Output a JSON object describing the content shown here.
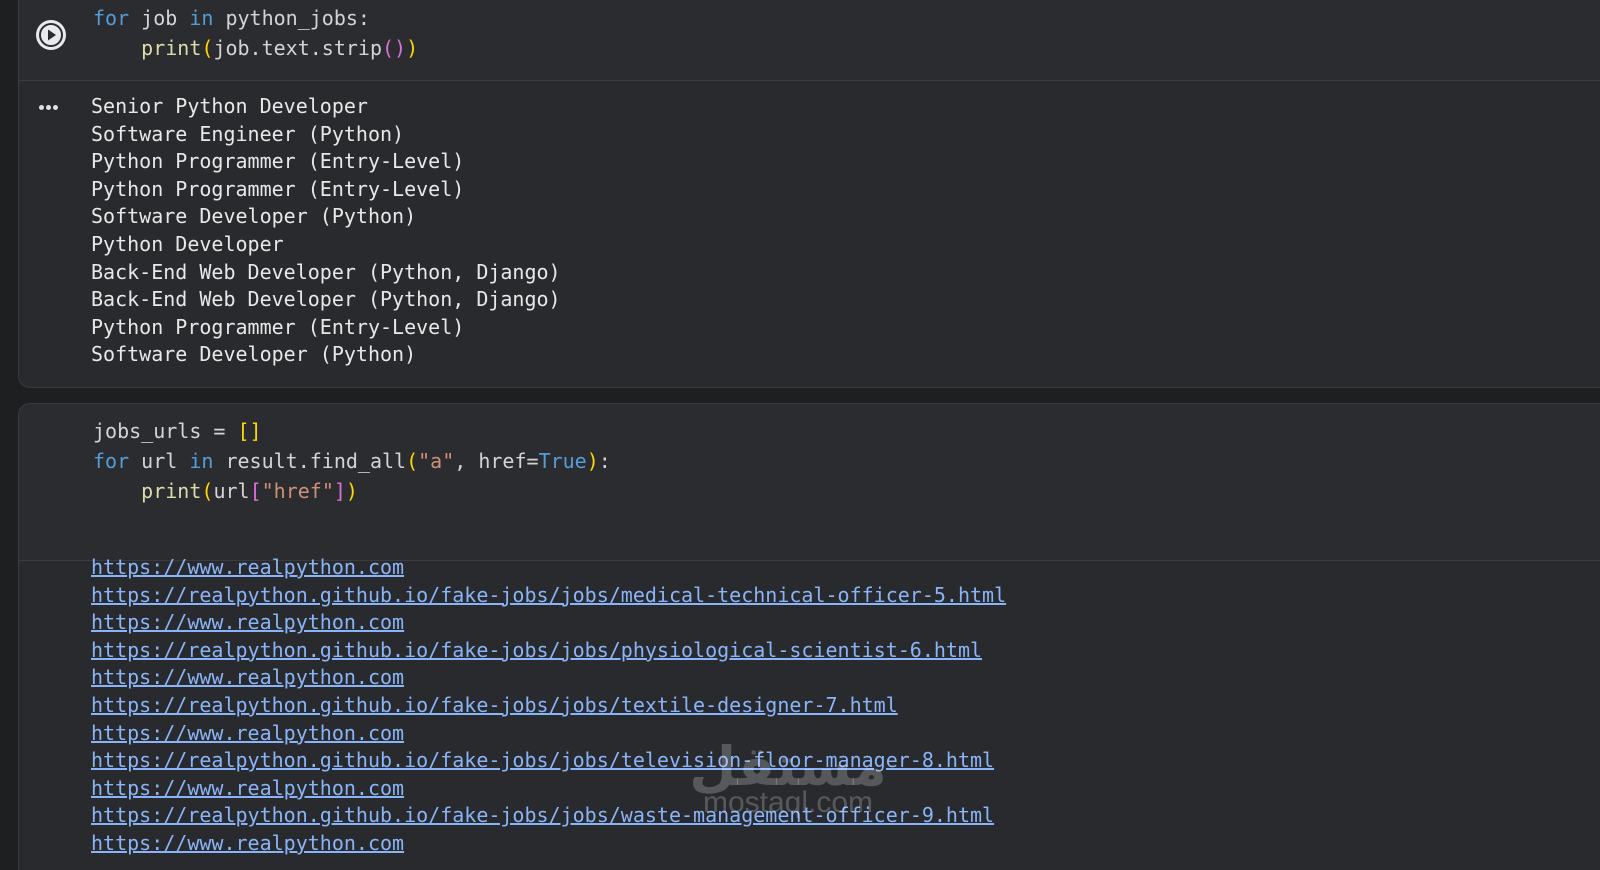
{
  "cell1": {
    "code_lines": [
      [
        {
          "t": "for",
          "c": "kw"
        },
        {
          "t": " job ",
          "c": "plain"
        },
        {
          "t": "in",
          "c": "kw"
        },
        {
          "t": " python_jobs:",
          "c": "plain"
        }
      ],
      [
        {
          "t": "    ",
          "c": "plain"
        },
        {
          "t": "print",
          "c": "fn"
        },
        {
          "t": "(",
          "c": "p1"
        },
        {
          "t": "job.text.strip",
          "c": "plain"
        },
        {
          "t": "()",
          "c": "p2"
        },
        {
          "t": ")",
          "c": "p1"
        }
      ]
    ],
    "output": [
      "Senior Python Developer",
      "Software Engineer (Python)",
      "Python Programmer (Entry-Level)",
      "Python Programmer (Entry-Level)",
      "Software Developer (Python)",
      "Python Developer",
      "Back-End Web Developer (Python, Django)",
      "Back-End Web Developer (Python, Django)",
      "Python Programmer (Entry-Level)",
      "Software Developer (Python)"
    ]
  },
  "cell2": {
    "code_lines": [
      [
        {
          "t": "jobs_urls = ",
          "c": "plain"
        },
        {
          "t": "[]",
          "c": "p1"
        }
      ],
      [
        {
          "t": "for",
          "c": "kw"
        },
        {
          "t": " url ",
          "c": "plain"
        },
        {
          "t": "in",
          "c": "kw"
        },
        {
          "t": " result.find_all",
          "c": "plain"
        },
        {
          "t": "(",
          "c": "p1"
        },
        {
          "t": "\"a\"",
          "c": "str"
        },
        {
          "t": ", href=",
          "c": "plain"
        },
        {
          "t": "True",
          "c": "bool"
        },
        {
          "t": ")",
          "c": "p1"
        },
        {
          "t": ":",
          "c": "plain"
        }
      ],
      [
        {
          "t": "    ",
          "c": "plain"
        },
        {
          "t": "print",
          "c": "fn"
        },
        {
          "t": "(",
          "c": "p1"
        },
        {
          "t": "url",
          "c": "plain"
        },
        {
          "t": "[",
          "c": "p2"
        },
        {
          "t": "\"href\"",
          "c": "str"
        },
        {
          "t": "]",
          "c": "p2"
        },
        {
          "t": ")",
          "c": "p1"
        }
      ]
    ],
    "output_links": [
      "https://www.realpython.com",
      "https://realpython.github.io/fake-jobs/jobs/medical-technical-officer-5.html",
      "https://www.realpython.com",
      "https://realpython.github.io/fake-jobs/jobs/physiological-scientist-6.html",
      "https://www.realpython.com",
      "https://realpython.github.io/fake-jobs/jobs/textile-designer-7.html",
      "https://www.realpython.com",
      "https://realpython.github.io/fake-jobs/jobs/television-floor-manager-8.html",
      "https://www.realpython.com",
      "https://realpython.github.io/fake-jobs/jobs/waste-management-officer-9.html",
      "https://www.realpython.com"
    ]
  },
  "icons": {
    "run": "play-icon",
    "output_menu": "more-horiz-icon"
  },
  "colors": {
    "background": "#1e1f21",
    "cell": "#282a2d",
    "keyword": "#569cd6",
    "function": "#dcdcaa",
    "bracket1": "#ffd700",
    "bracket2": "#da70d6",
    "string": "#ce9178",
    "link": "#8ab4f8"
  },
  "watermark": {
    "arabic": "مستقل",
    "latin": "mostaql.com"
  }
}
